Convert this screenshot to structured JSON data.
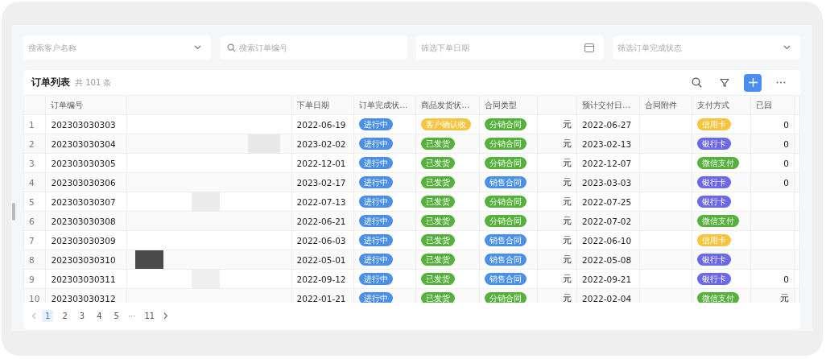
{
  "filters": [
    {
      "kind": "select",
      "placeholder": "搜索客户名称"
    },
    {
      "kind": "search",
      "placeholder": "搜索订单编号"
    },
    {
      "kind": "date",
      "placeholder": "筛选下单日期"
    },
    {
      "kind": "select",
      "placeholder": "筛选订单完成状态"
    }
  ],
  "table_card": {
    "title": "订单列表",
    "count": "共 101 条",
    "columns": [
      "订单编号",
      "",
      "下单日期",
      "订单完成状…",
      "商品发货状…",
      "合同类型",
      "",
      "预计交付日…",
      "合同附件",
      "支付方式",
      "已回"
    ],
    "rows": [
      {
        "index": "1",
        "order_no": "202303030303",
        "order_date": "2022-06-19",
        "completion": {
          "text": "进行中",
          "color": "#4a8fe8"
        },
        "shipping": {
          "text": "客户确认收",
          "color": "#f5c440"
        },
        "contract": {
          "text": "分销合同",
          "color": "#55b13c"
        },
        "amount": "元",
        "delivery_date": "2022-06-27",
        "payment": {
          "text": "信用卡",
          "color": "#f5c440"
        },
        "received": "0"
      },
      {
        "index": "2",
        "order_no": "202303030304",
        "order_date": "2023-02-02",
        "completion": {
          "text": "进行中",
          "color": "#4a8fe8"
        },
        "shipping": {
          "text": "已发货",
          "color": "#55b13c"
        },
        "contract": {
          "text": "分销合同",
          "color": "#55b13c"
        },
        "amount": "元",
        "delivery_date": "2023-02-13",
        "payment": {
          "text": "银行卡",
          "color": "#6d68e8"
        },
        "received": "0"
      },
      {
        "index": "3",
        "order_no": "202303030305",
        "order_date": "2022-12-01",
        "completion": {
          "text": "进行中",
          "color": "#4a8fe8"
        },
        "shipping": {
          "text": "已发货",
          "color": "#55b13c"
        },
        "contract": {
          "text": "分销合同",
          "color": "#55b13c"
        },
        "amount": "元",
        "delivery_date": "2022-12-07",
        "payment": {
          "text": "微信支付",
          "color": "#55b13c"
        },
        "received": "0"
      },
      {
        "index": "4",
        "order_no": "202303030306",
        "order_date": "2023-02-17",
        "completion": {
          "text": "进行中",
          "color": "#4a8fe8"
        },
        "shipping": {
          "text": "已发货",
          "color": "#55b13c"
        },
        "contract": {
          "text": "销售合同",
          "color": "#4a8fe8"
        },
        "amount": "元",
        "delivery_date": "2023-03-03",
        "payment": {
          "text": "银行卡",
          "color": "#6d68e8"
        },
        "received": "0"
      },
      {
        "index": "5",
        "order_no": "202303030307",
        "order_date": "2022-07-13",
        "completion": {
          "text": "进行中",
          "color": "#4a8fe8"
        },
        "shipping": {
          "text": "已发货",
          "color": "#55b13c"
        },
        "contract": {
          "text": "分销合同",
          "color": "#55b13c"
        },
        "amount": "元",
        "delivery_date": "2022-07-25",
        "payment": {
          "text": "银行卡",
          "color": "#6d68e8"
        }
      },
      {
        "index": "6",
        "order_no": "202303030308",
        "order_date": "2022-06-21",
        "completion": {
          "text": "进行中",
          "color": "#4a8fe8"
        },
        "shipping": {
          "text": "已发货",
          "color": "#55b13c"
        },
        "contract": {
          "text": "分销合同",
          "color": "#55b13c"
        },
        "amount": "元",
        "delivery_date": "2022-07-02",
        "payment": {
          "text": "微信支付",
          "color": "#55b13c"
        }
      },
      {
        "index": "7",
        "order_no": "202303030309",
        "order_date": "2022-06-03",
        "completion": {
          "text": "进行中",
          "color": "#4a8fe8"
        },
        "shipping": {
          "text": "已发货",
          "color": "#55b13c"
        },
        "contract": {
          "text": "销售合同",
          "color": "#4a8fe8"
        },
        "amount": "元",
        "delivery_date": "2022-06-10",
        "payment": {
          "text": "信用卡",
          "color": "#f5c440"
        }
      },
      {
        "index": "8",
        "order_no": "202303030310",
        "order_date": "2022-05-01",
        "completion": {
          "text": "进行中",
          "color": "#4a8fe8"
        },
        "shipping": {
          "text": "已发货",
          "color": "#55b13c"
        },
        "contract": {
          "text": "销售合同",
          "color": "#4a8fe8"
        },
        "amount": "元",
        "delivery_date": "2022-05-08",
        "payment": {
          "text": "银行卡",
          "color": "#6d68e8"
        }
      },
      {
        "index": "9",
        "order_no": "202303030311",
        "order_date": "2022-09-12",
        "completion": {
          "text": "进行中",
          "color": "#4a8fe8"
        },
        "shipping": {
          "text": "已发货",
          "color": "#55b13c"
        },
        "contract": {
          "text": "销售合同",
          "color": "#4a8fe8"
        },
        "amount": "元",
        "delivery_date": "2022-09-21",
        "payment": {
          "text": "银行卡",
          "color": "#6d68e8"
        },
        "received": "0"
      },
      {
        "index": "10",
        "order_no": "202303030312",
        "order_date": "2022-01-21",
        "completion": {
          "text": "进行中",
          "color": "#4a8fe8"
        },
        "shipping": {
          "text": "已发货",
          "color": "#55b13c"
        },
        "contract": {
          "text": "分销合同",
          "color": "#55b13c"
        },
        "amount": "元",
        "delivery_date": "2022-02-04",
        "payment": {
          "text": "微信支付",
          "color": "#55b13c"
        },
        "received": "元"
      }
    ]
  },
  "pagination": {
    "pages": [
      {
        "label": "1",
        "selected": true
      },
      {
        "label": "2",
        "selected": false
      },
      {
        "label": "3",
        "selected": false
      },
      {
        "label": "4",
        "selected": false
      },
      {
        "label": "5",
        "selected": false
      }
    ],
    "ellipsis": "···",
    "last": {
      "label": "11",
      "selected": false
    }
  }
}
